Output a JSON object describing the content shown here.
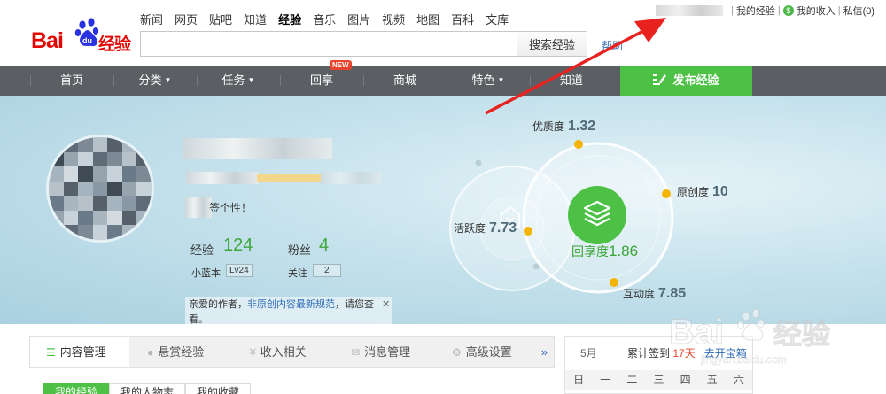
{
  "header": {
    "logo_bai": "Bai",
    "logo_du": "du",
    "logo_jingyan": "经验",
    "nav": [
      "新闻",
      "网页",
      "贴吧",
      "知道",
      "经验",
      "音乐",
      "图片",
      "视频",
      "地图",
      "百科",
      "文库"
    ],
    "active_nav": "经验",
    "search_value": "",
    "search_button": "搜索经验",
    "help_link": "帮助",
    "user_links": [
      "我的经验",
      "我的收入",
      "私信(0)"
    ]
  },
  "navbar": {
    "items": [
      "首页",
      "分类",
      "任务",
      "回享",
      "商城",
      "特色",
      "知道"
    ],
    "new_badge": "NEW",
    "publish": "发布经验"
  },
  "profile": {
    "signature": "签个性！",
    "exp_label": "经验",
    "exp_value": "124",
    "fans_label": "粉丝",
    "fans_value": "4",
    "blue_label": "小蓝本",
    "level": "Lv24",
    "follow_label": "关注",
    "follow_value": "2",
    "notice_pre": "亲爱的作者，",
    "notice_link": "非原创内容最新规范",
    "notice_post": "，请您查看。",
    "notice_close": "✕"
  },
  "metrics": {
    "quality": {
      "label": "优质度",
      "value": "1.32"
    },
    "original": {
      "label": "原创度",
      "value": "10"
    },
    "activity": {
      "label": "活跃度",
      "value": "7.73"
    },
    "huixiang": {
      "label": "回享度",
      "value": "1.86"
    },
    "interaction": {
      "label": "互动度",
      "value": "7.85"
    }
  },
  "tabs": {
    "items": [
      "内容管理",
      "悬赏经验",
      "收入相关",
      "消息管理",
      "高级设置"
    ],
    "more": "»",
    "subtabs": [
      "我的经验",
      "我的人物志",
      "我的收藏"
    ]
  },
  "calendar": {
    "month": "5月",
    "sign_pre": "累计签到",
    "sign_days": "17天",
    "open_box": "去开宝箱",
    "weekdays": [
      "日",
      "一",
      "二",
      "三",
      "四",
      "五",
      "六"
    ]
  },
  "watermark": {
    "brand": "Bai",
    "du": "du",
    "jy": "经验",
    "url": "jingyan.baidu.com"
  },
  "colors": {
    "brand_red": "#e10601",
    "green": "#4cc145",
    "navbar": "#5b5e63",
    "banner": "#c6e2ec",
    "arrow": "#e8231f"
  }
}
